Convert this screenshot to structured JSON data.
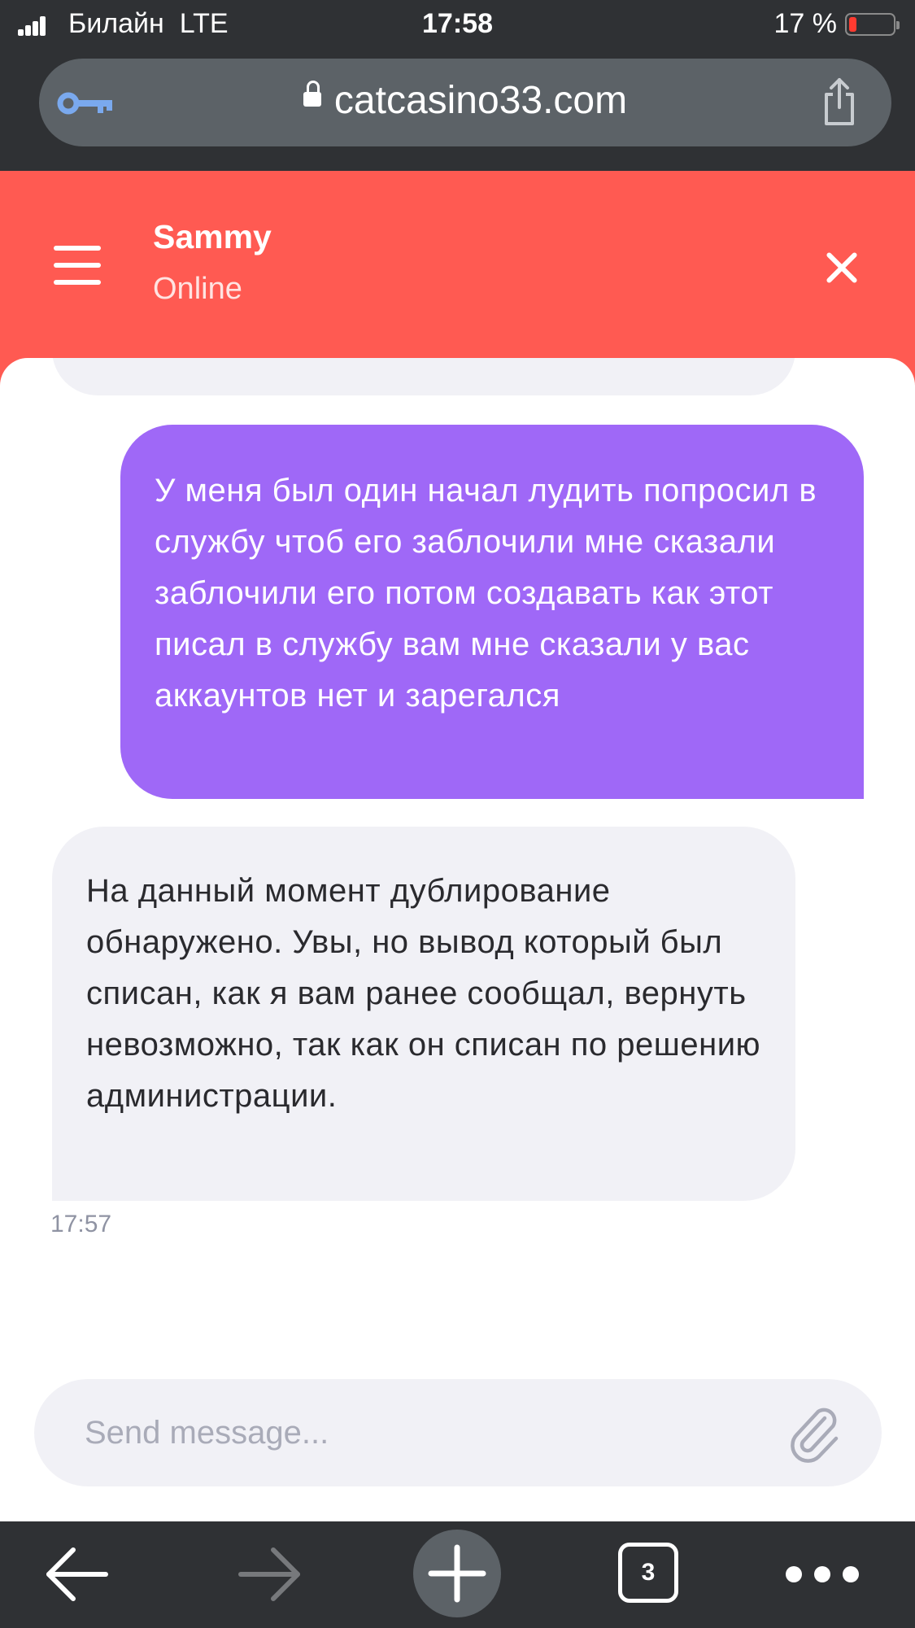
{
  "status_bar": {
    "carrier": "Билайн  LTE",
    "time": "17:58",
    "battery": "17 %",
    "battery_level": 0.17
  },
  "browser": {
    "url": "catcasino33.com",
    "open_tabs": "3",
    "colors": {
      "chrome": "#2f3134",
      "url_bar": "#5c6267",
      "key_icon": "#7aa9ee"
    }
  },
  "chat": {
    "agent_name": "Sammy",
    "agent_status": "Online",
    "messages": [
      {
        "from": "user",
        "text": "У меня был один начал лудить попросил в службу чтоб его заблочили мне сказали заблочили его потом создавать как этот писал в службу вам мне сказали у вас аккаунтов нет и зарегался"
      },
      {
        "from": "agent",
        "text": "На данный момент дублирование обнаружено. Увы, но вывод который был списан, как я вам ранее сообщал, вернуть невозможно, так как он списан по решению администрации.",
        "time": "17:57"
      }
    ],
    "composer_placeholder": "Send message...",
    "colors": {
      "header": "#ff5a52",
      "user_bubble": "#9f68f7",
      "agent_bubble": "#f1f1f6"
    }
  }
}
